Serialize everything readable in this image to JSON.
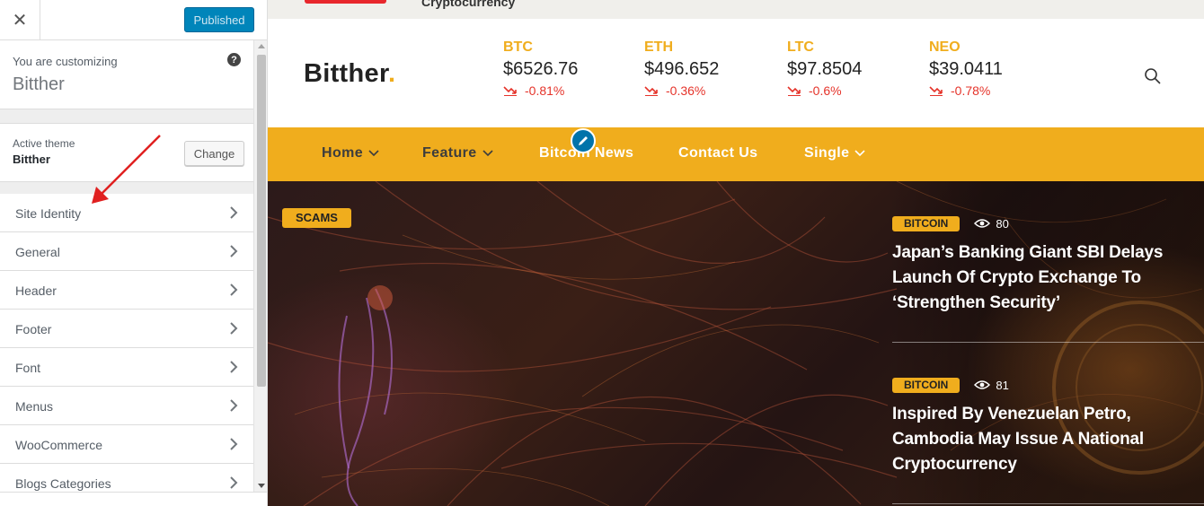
{
  "customizer": {
    "close_icon": "close-icon",
    "publish_label": "Published",
    "customizing_label": "You are customizing",
    "site_name": "Bitther",
    "help_glyph": "?",
    "active_theme_label": "Active theme",
    "active_theme_name": "Bitther",
    "change_label": "Change",
    "sections": [
      {
        "label": "Site Identity"
      },
      {
        "label": "General"
      },
      {
        "label": "Header"
      },
      {
        "label": "Footer"
      },
      {
        "label": "Font"
      },
      {
        "label": "Menus"
      },
      {
        "label": "WooCommerce"
      },
      {
        "label": "Blogs Categories"
      }
    ]
  },
  "preview": {
    "topstrip_text": "Cryptocurrency",
    "logo_text": "Bitther",
    "logo_dot": ".",
    "tickers": [
      {
        "symbol": "BTC",
        "price": "$6526.76",
        "change": "-0.81%"
      },
      {
        "symbol": "ETH",
        "price": "$496.652",
        "change": "-0.36%"
      },
      {
        "symbol": "LTC",
        "price": "$97.8504",
        "change": "-0.6%"
      },
      {
        "symbol": "NEO",
        "price": "$39.0411",
        "change": "-0.78%"
      }
    ],
    "nav": [
      {
        "label": "Home",
        "dropdown": true
      },
      {
        "label": "Feature",
        "dropdown": true
      },
      {
        "label": "Bitcoin News",
        "dropdown": false
      },
      {
        "label": "Contact Us",
        "dropdown": false
      },
      {
        "label": "Single",
        "dropdown": true
      }
    ],
    "hero_badge": "SCAMS",
    "stories": [
      {
        "category": "BITCOIN",
        "views": "80",
        "headline": "Japan’s Banking Giant SBI Delays Launch Of Crypto Exchange To ‘Strengthen Security’"
      },
      {
        "category": "BITCOIN",
        "views": "81",
        "headline": "Inspired By Venezuelan Petro, Cambodia May Issue A National Cryptocurrency"
      }
    ]
  },
  "colors": {
    "accent": "#f0ad1d",
    "negative": "#e5332a",
    "wp_blue": "#0085ba"
  }
}
